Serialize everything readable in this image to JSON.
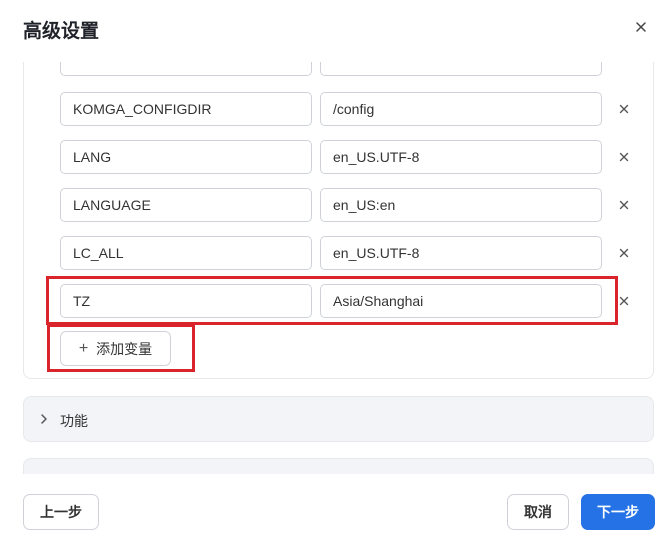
{
  "dialog": {
    "title": "高级设置"
  },
  "env": {
    "partial_row": {
      "key": "",
      "value": ""
    },
    "rows": [
      {
        "key": "KOMGA_CONFIGDIR",
        "value": "/config"
      },
      {
        "key": "LANG",
        "value": "en_US.UTF-8"
      },
      {
        "key": "LANGUAGE",
        "value": "en_US:en"
      },
      {
        "key": "LC_ALL",
        "value": "en_US.UTF-8"
      },
      {
        "key": "TZ",
        "value": "Asia/Shanghai"
      }
    ],
    "add_button_label": "添加变量"
  },
  "sections": [
    {
      "label": "功能"
    },
    {
      "label": ""
    }
  ],
  "footer": {
    "prev_label": "上一步",
    "cancel_label": "取消",
    "next_label": "下一步"
  },
  "colors": {
    "primary": "#2472e6",
    "highlight": "#d9242b",
    "section_bg": "#f2f4f7"
  }
}
